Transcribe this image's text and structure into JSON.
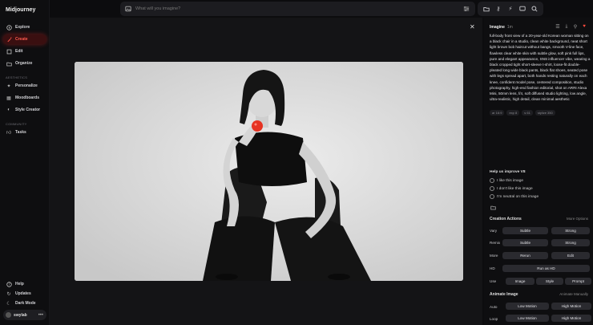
{
  "sidebar": {
    "brand": "Midjourney",
    "items": [
      {
        "label": "Explore"
      },
      {
        "label": "Create"
      },
      {
        "label": "Edit"
      },
      {
        "label": "Organize"
      }
    ],
    "aesthetics_label": "AESTHETICS",
    "aesthetics_items": [
      {
        "label": "Personalize"
      },
      {
        "label": "Moodboards"
      },
      {
        "label": "Style Creator"
      }
    ],
    "community_label": "COMMUNITY",
    "community_items": [
      {
        "label": "Tasks"
      }
    ],
    "bottom_items": [
      {
        "label": "Help"
      },
      {
        "label": "Updates"
      },
      {
        "label": "Dark Mode"
      }
    ],
    "user": {
      "name": "swylab",
      "more": "•••"
    }
  },
  "search": {
    "placeholder": "What will you imagine?"
  },
  "accent_color": "#ff4b3e",
  "panel": {
    "title": "Imagine",
    "age": "1m",
    "prompt": "full-body front view of a 20-year-old Korean woman sitting on a black chair in a studio, clean white background, neat short light brown bob haircut without bangs, smooth V-line face, flawless clear white skin with subtle glow, soft pink full lips, pure and elegant appearance, SNS influencer vibe, wearing a black cropped tight short-sleeve t-shirt, loose-fit double-pleated long wide black pants, black flat shoes, seated pose with legs spread apart, both hands resting naturally on each knee, confident model pose, centered composition, studio photography, high-end fashion editorial, shot on ARRI Alexa Mini, 50mm lens, f/4, soft diffused studio lighting, low angle, ultra-realistic, high detail, clean minimal aesthetic",
    "params": [
      "ar 16:9",
      "exp 8",
      "s 61",
      "stylize 350"
    ],
    "help_title": "Help us improve V8",
    "feedback": [
      "I like this image",
      "I don't like this image",
      "I'm neutral on this image"
    ],
    "creation_actions_label": "Creation Actions",
    "more_options_label": "More Options",
    "rows": [
      {
        "label": "Vary",
        "buttons": [
          "Subtle",
          "Strong"
        ]
      },
      {
        "label": "Remix",
        "buttons": [
          "Subtle",
          "Strong"
        ]
      },
      {
        "label": "More",
        "buttons": [
          "Rerun",
          "Edit"
        ]
      },
      {
        "label": "HD",
        "buttons": [
          "Run as HD"
        ]
      },
      {
        "label": "Use",
        "buttons": [
          "Image",
          "Style",
          "Prompt"
        ]
      }
    ],
    "animate_label": "Animate Image",
    "animate_manually_label": "Animate Manually",
    "animate_rows": [
      {
        "label": "Auto",
        "buttons": [
          "Low Motion",
          "High Motion"
        ]
      },
      {
        "label": "Loop",
        "buttons": [
          "Low Motion",
          "High Motion"
        ]
      }
    ]
  }
}
